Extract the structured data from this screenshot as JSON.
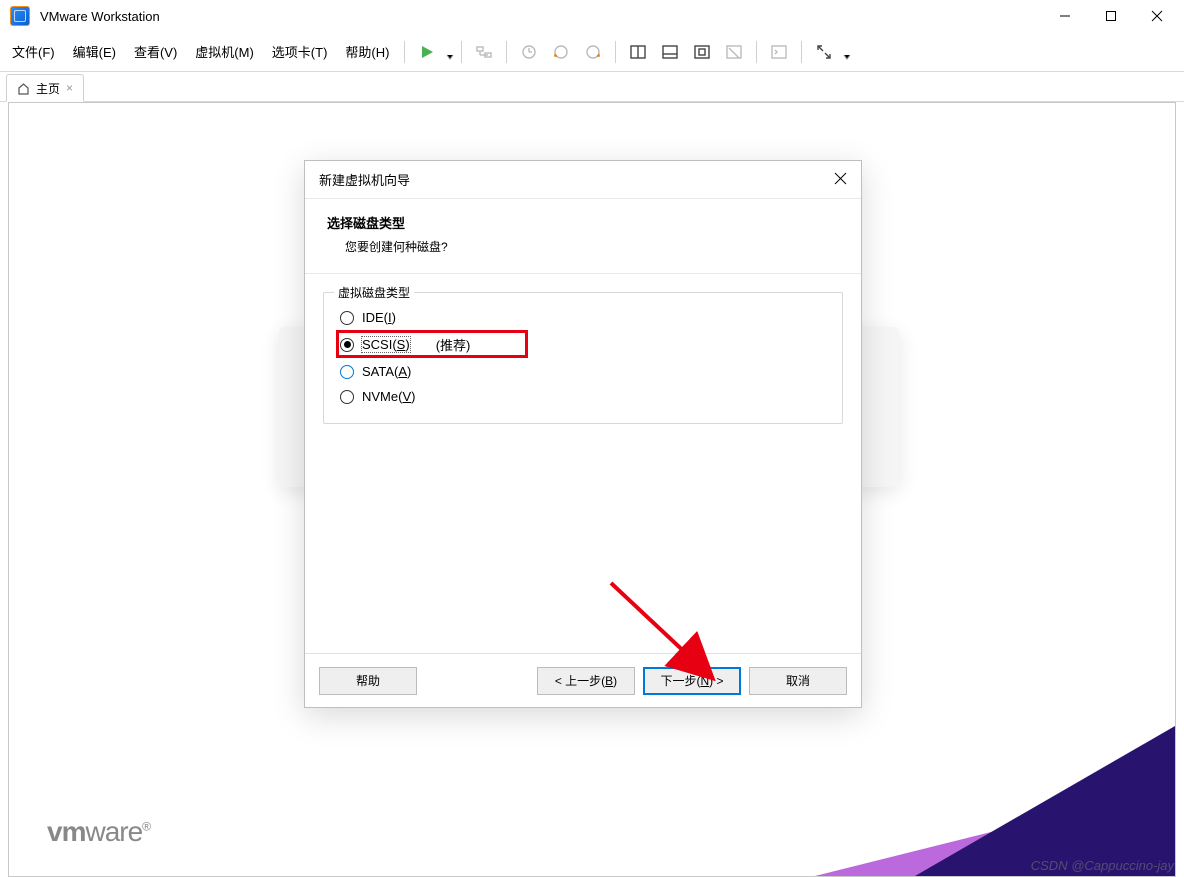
{
  "title_bar": {
    "app_title": "VMware Workstation"
  },
  "menu": {
    "file": "文件(F)",
    "edit": "编辑(E)",
    "view": "查看(V)",
    "vm": "虚拟机(M)",
    "tabs": "选项卡(T)",
    "help": "帮助(H)"
  },
  "tabs": {
    "home": "主页"
  },
  "dialog": {
    "title": "新建虚拟机向导",
    "heading": "选择磁盘类型",
    "subheading": "您要创建何种磁盘?",
    "group_label": "虚拟磁盘类型",
    "options": {
      "ide": "IDE(I)",
      "scsi": "SCSI(S)",
      "scsi_rec": "(推荐)",
      "sata": "SATA(A)",
      "nvme": "NVMe(V)"
    },
    "buttons": {
      "help": "帮助",
      "back": "< 上一步(B)",
      "next": "下一步(N) >",
      "cancel": "取消"
    }
  },
  "logo": {
    "prefix": "vm",
    "suffix": "ware",
    "reg": "®"
  },
  "watermark": "CSDN @Cappuccino-jay"
}
